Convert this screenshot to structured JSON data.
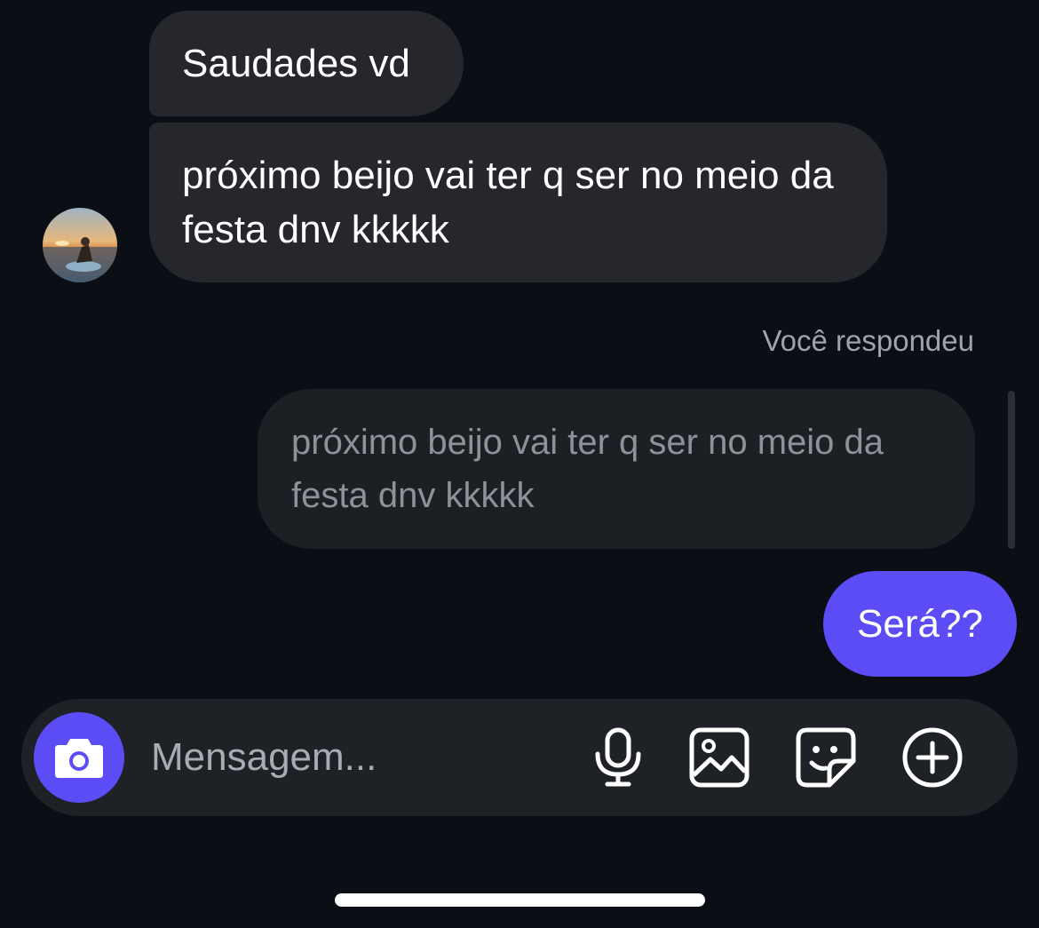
{
  "conversation": {
    "received_messages": [
      {
        "text": "Saudades vd"
      },
      {
        "text": "próximo beijo vai ter q ser no meio da festa dnv kkkkk"
      }
    ],
    "reply_label": "Você respondeu",
    "quoted_message": "próximo beijo vai ter q ser no meio da festa dnv kkkkk",
    "sent_message": "Será??"
  },
  "composer": {
    "placeholder": "Mensagem...",
    "icons": [
      "camera-icon",
      "microphone-icon",
      "gallery-icon",
      "sticker-icon",
      "add-icon"
    ]
  },
  "colors": {
    "background": "#0b0f15",
    "received_bubble": "#25272c",
    "quoted_bubble": "#1c1f24",
    "accent": "#5b4cf5",
    "composer": "#1e2126"
  }
}
